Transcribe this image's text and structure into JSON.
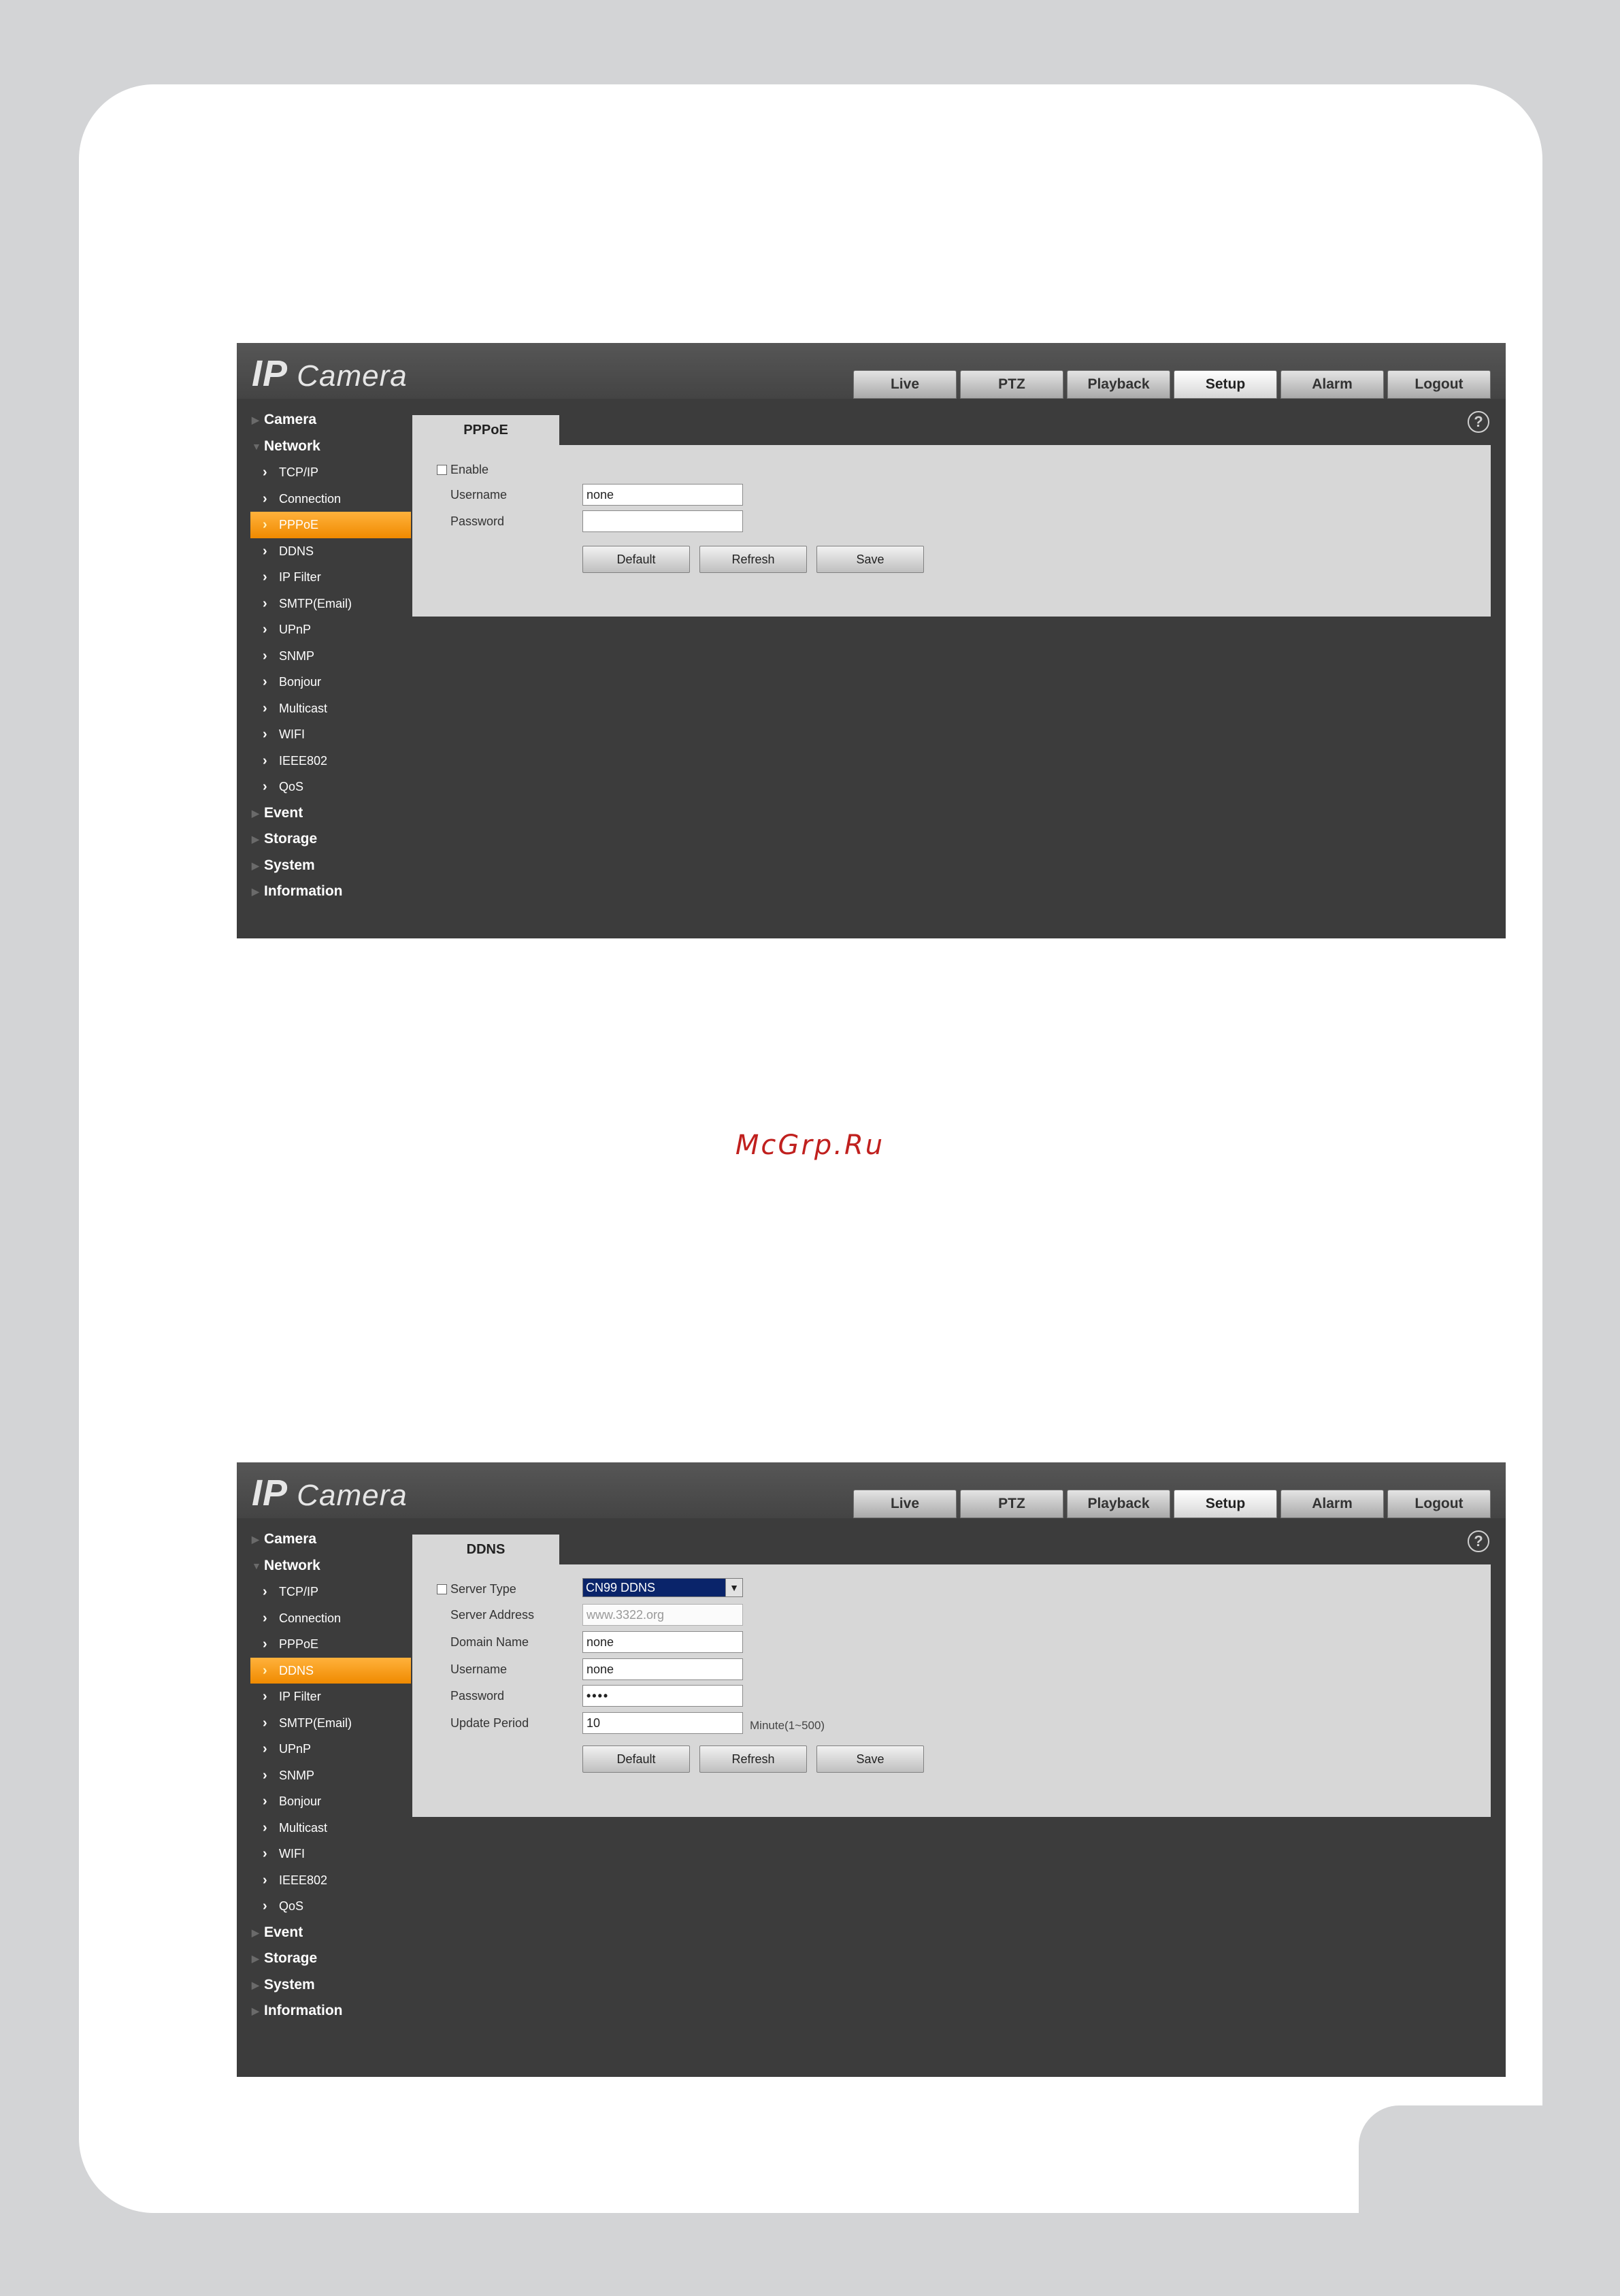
{
  "watermark": "McGrp.Ru",
  "app": {
    "logo_ip": "IP",
    "logo_camera": "Camera",
    "nav": [
      "Live",
      "PTZ",
      "Playback",
      "Setup",
      "Alarm",
      "Logout"
    ],
    "help": "?"
  },
  "sidebar": {
    "groups": [
      "Camera",
      "Network",
      "Event",
      "Storage",
      "System",
      "Information"
    ],
    "network_items": [
      "TCP/IP",
      "Connection",
      "PPPoE",
      "DDNS",
      "IP Filter",
      "SMTP(Email)",
      "UPnP",
      "SNMP",
      "Bonjour",
      "Multicast",
      "WIFI",
      "IEEE802",
      "QoS"
    ]
  },
  "pppoe": {
    "tab": "PPPoE",
    "enable_label": "Enable",
    "username_label": "Username",
    "username_value": "none",
    "password_label": "Password",
    "password_value": "",
    "buttons": [
      "Default",
      "Refresh",
      "Save"
    ]
  },
  "ddns": {
    "tab": "DDNS",
    "server_type_label": "Server Type",
    "server_type_value": "CN99 DDNS",
    "server_address_label": "Server Address",
    "server_address_value": "www.3322.org",
    "domain_name_label": "Domain Name",
    "domain_name_value": "none",
    "username_label": "Username",
    "username_value": "none",
    "password_label": "Password",
    "password_value": "••••",
    "update_period_label": "Update Period",
    "update_period_value": "10",
    "update_period_hint": "Minute(1~500)",
    "buttons": [
      "Default",
      "Refresh",
      "Save"
    ]
  }
}
